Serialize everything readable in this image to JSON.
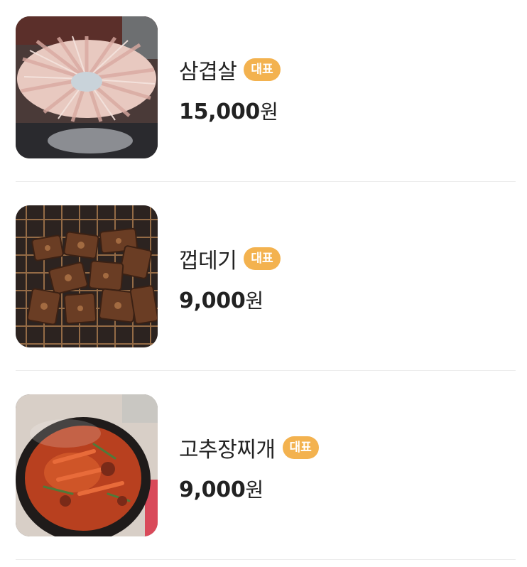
{
  "menu": {
    "items": [
      {
        "name": "삼겹살",
        "badge": "대표",
        "price": "15,000",
        "unit": "원",
        "image_icon": "pork-belly-photo"
      },
      {
        "name": "껍데기",
        "badge": "대표",
        "price": "9,000",
        "unit": "원",
        "image_icon": "grilled-pork-skin-photo"
      },
      {
        "name": "고추장찌개",
        "badge": "대표",
        "price": "9,000",
        "unit": "원",
        "image_icon": "gochujang-stew-photo"
      }
    ]
  },
  "colors": {
    "badge_bg": "#f3b24f",
    "text": "#222222",
    "divider": "#ececec"
  }
}
